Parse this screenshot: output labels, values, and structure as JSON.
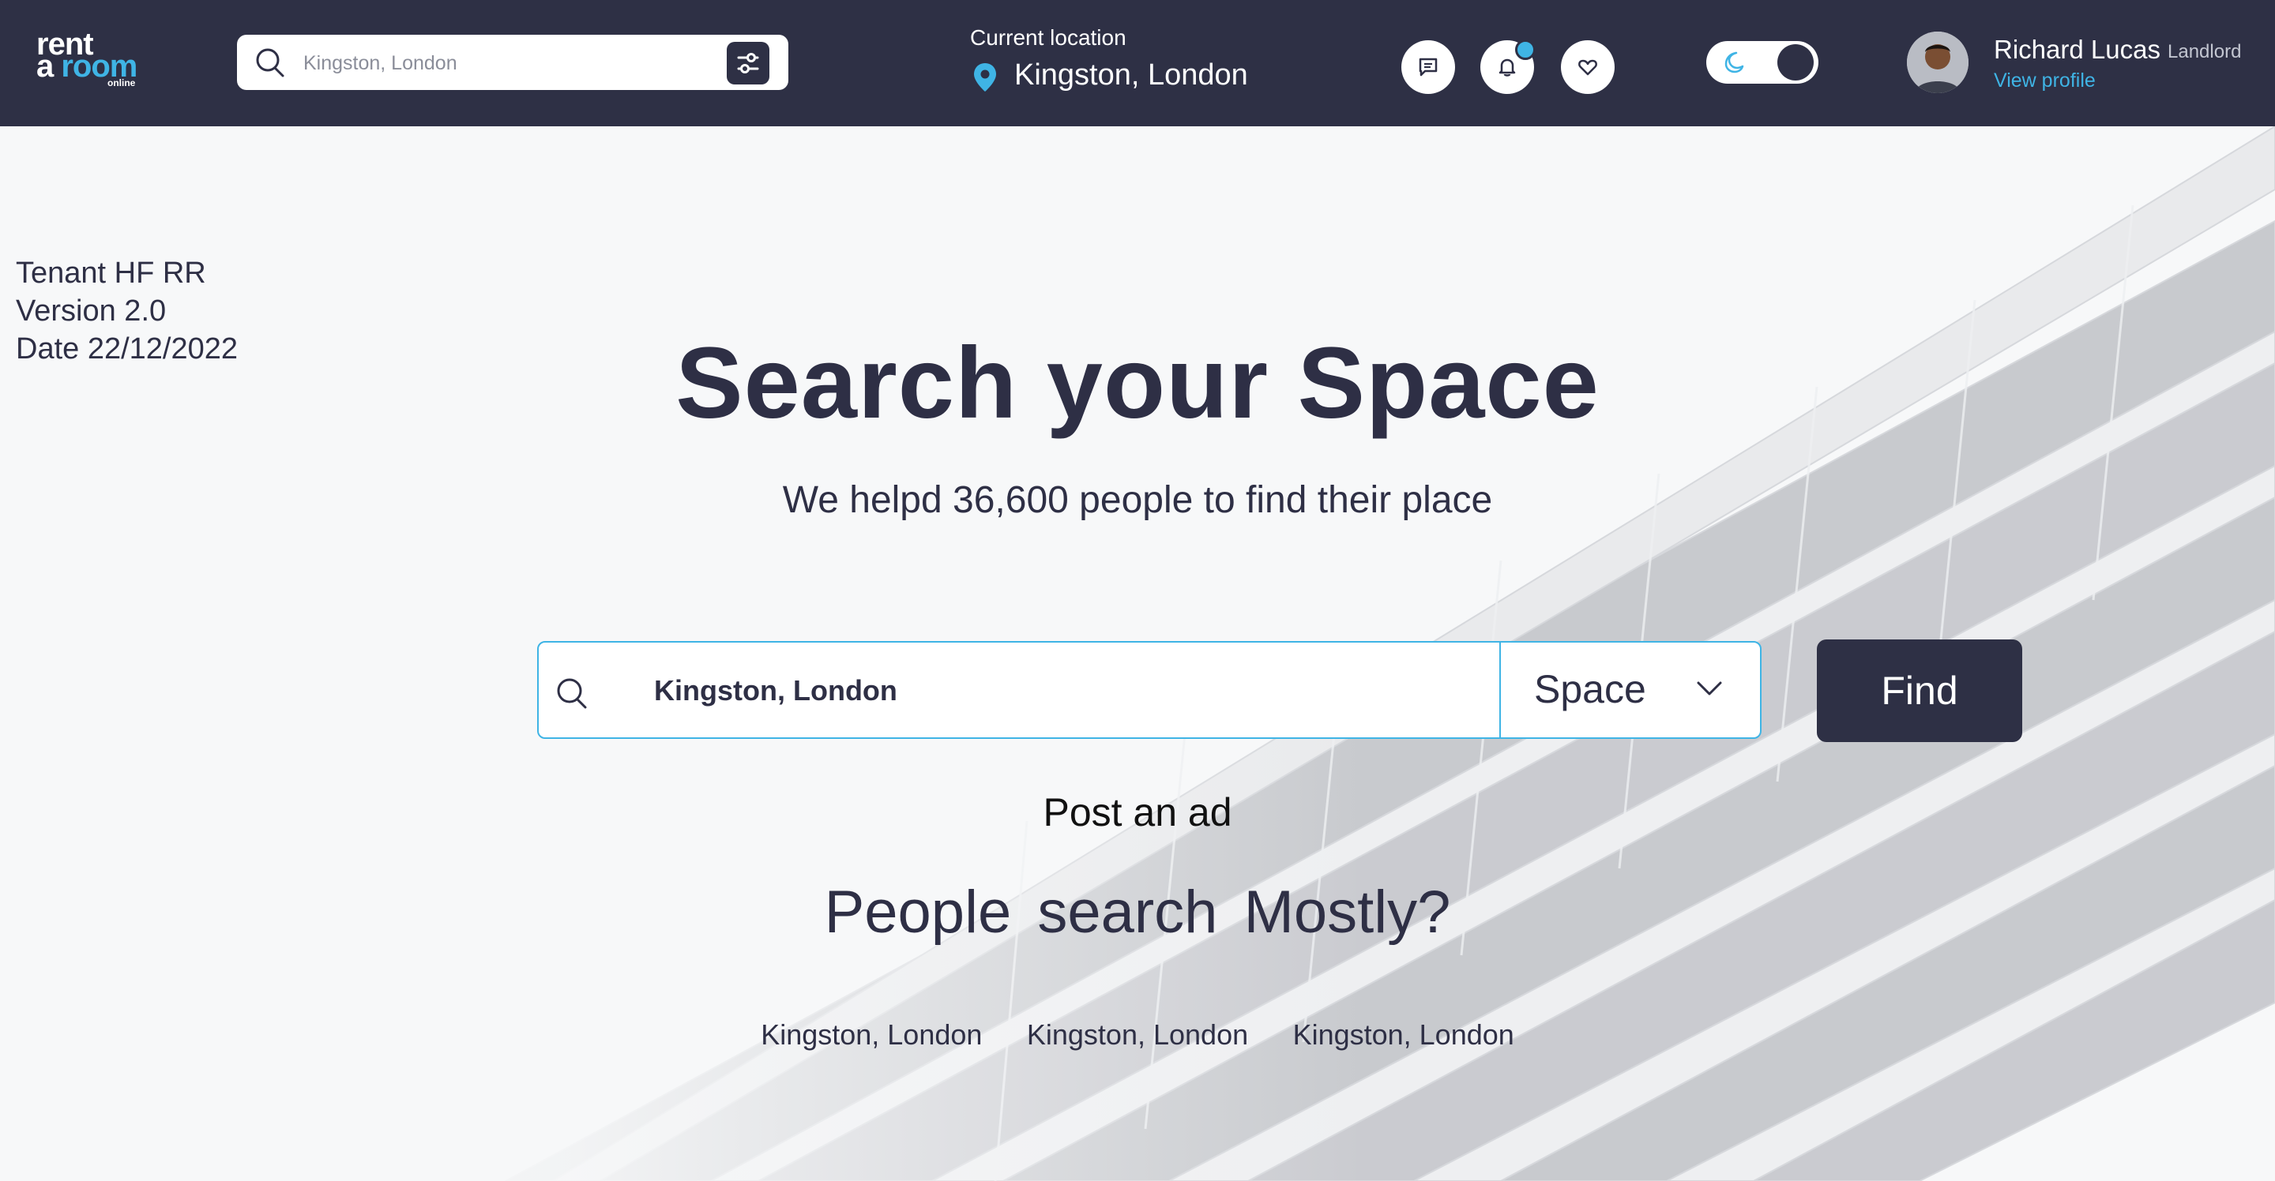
{
  "header": {
    "logo": {
      "line1": "rent",
      "line2_a": "a ",
      "line2_b": "room",
      "line3": "online"
    },
    "search": {
      "placeholder": "Kingston, London"
    },
    "current_location": {
      "label": "Current location",
      "value": "Kingston, London"
    },
    "icons": [
      "chat-icon",
      "bell-icon",
      "heart-icon",
      "moon-icon",
      "filter-icon",
      "search-icon",
      "location-pin-icon"
    ],
    "user": {
      "name": "Richard Lucas",
      "role": "Landlord",
      "profile_link": "View profile"
    }
  },
  "meta": {
    "line1": "Tenant HF RR",
    "line2": "Version 2.0",
    "line3": "Date 22/12/2022"
  },
  "hero": {
    "title": "Search your Space",
    "subtitle": "We helpd 36,600 people to find their place"
  },
  "search": {
    "value": "Kingston, London",
    "type_selected": "Space",
    "find_label": "Find"
  },
  "post_ad": "Post an ad",
  "people_search": {
    "title": "People  search  Mostly?",
    "items": [
      "Kingston, London",
      "Kingston, London",
      "Kingston, London"
    ]
  },
  "colors": {
    "navy": "#2e3045",
    "accent": "#3fb4e5",
    "background": "#f7f8f9"
  }
}
